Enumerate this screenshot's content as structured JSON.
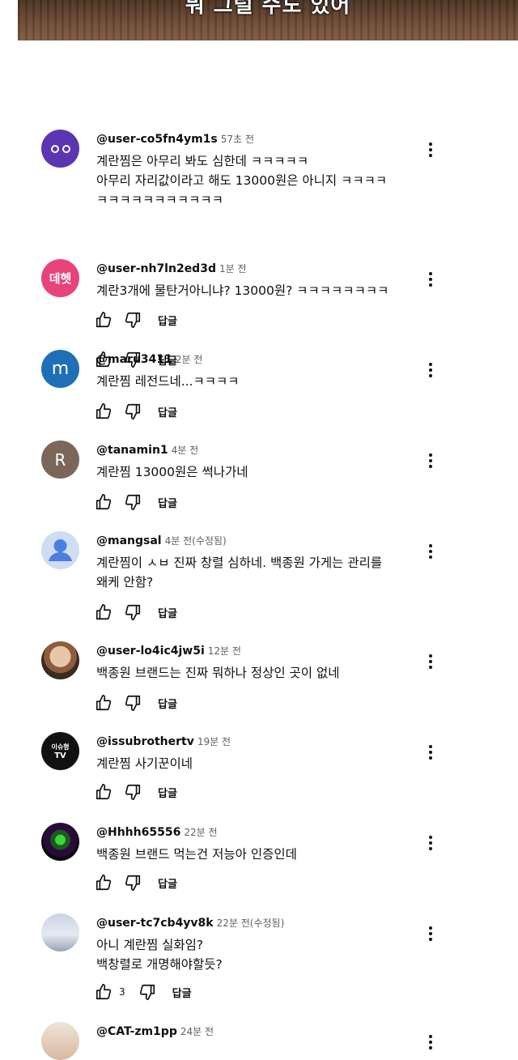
{
  "video": {
    "caption": "뭐 그럴 수도 있어"
  },
  "ui": {
    "reply_label": "답글"
  },
  "comments": [
    {
      "handle": "@user-co5fn4ym1s",
      "time": "57초 전",
      "avatar_text": "",
      "body": "계란찜은 아무리 봐도 심한데 ㅋㅋㅋㅋㅋ\n아무리 자리값이라고 해도 13000원은 아니지 ㅋㅋㅋㅋ\nㅋㅋㅋㅋㅋㅋㅋㅋㅋㅋㅋ",
      "likes": ""
    },
    {
      "handle": "@user-nh7ln2ed3d",
      "time": "1분 전",
      "avatar_text": "데헷",
      "body": "계란3개에 물탄거아니냐? 13000원? ㅋㅋㅋㅋㅋㅋㅋㅋ",
      "likes": ""
    },
    {
      "handle": "@maru3411",
      "time": "2분 전",
      "avatar_text": "m",
      "body": "계란찜 레전드네...ㅋㅋㅋㅋ",
      "likes": ""
    },
    {
      "handle": "@tanamin1",
      "time": "4분 전",
      "avatar_text": "R",
      "body": "계란찜 13000원은 썩나가네",
      "likes": ""
    },
    {
      "handle": "@mangsal",
      "time": "4분 전(수정됨)",
      "avatar_text": "",
      "body": "계란찜이 ㅅㅂ 진짜 창렬 심하네. 백종원 가게는 관리를\n왜케 안함?",
      "likes": ""
    },
    {
      "handle": "@user-lo4ic4jw5i",
      "time": "12분 전",
      "avatar_text": "",
      "body": "백종원 브랜드는 진짜 뭐하나 정상인 곳이 없네",
      "likes": ""
    },
    {
      "handle": "@issubrothertv",
      "time": "19분 전",
      "avatar_text": "이슈형",
      "avatar_text2": "TV",
      "body": "계란찜 사기꾼이네",
      "likes": ""
    },
    {
      "handle": "@Hhhh65556",
      "time": "22분 전",
      "avatar_text": "",
      "body": "백종원 브랜드 먹는건 저능아 인증인데",
      "likes": ""
    },
    {
      "handle": "@user-tc7cb4yv8k",
      "time": "22분 전(수정됨)",
      "avatar_text": "",
      "body": "아니 계란찜 실화임?\n백창렬로 개명해야할듯?",
      "likes": "3"
    },
    {
      "handle": "@CAT-zm1pp",
      "time": "24분 전",
      "avatar_text": "",
      "body": "",
      "likes": ""
    }
  ]
}
